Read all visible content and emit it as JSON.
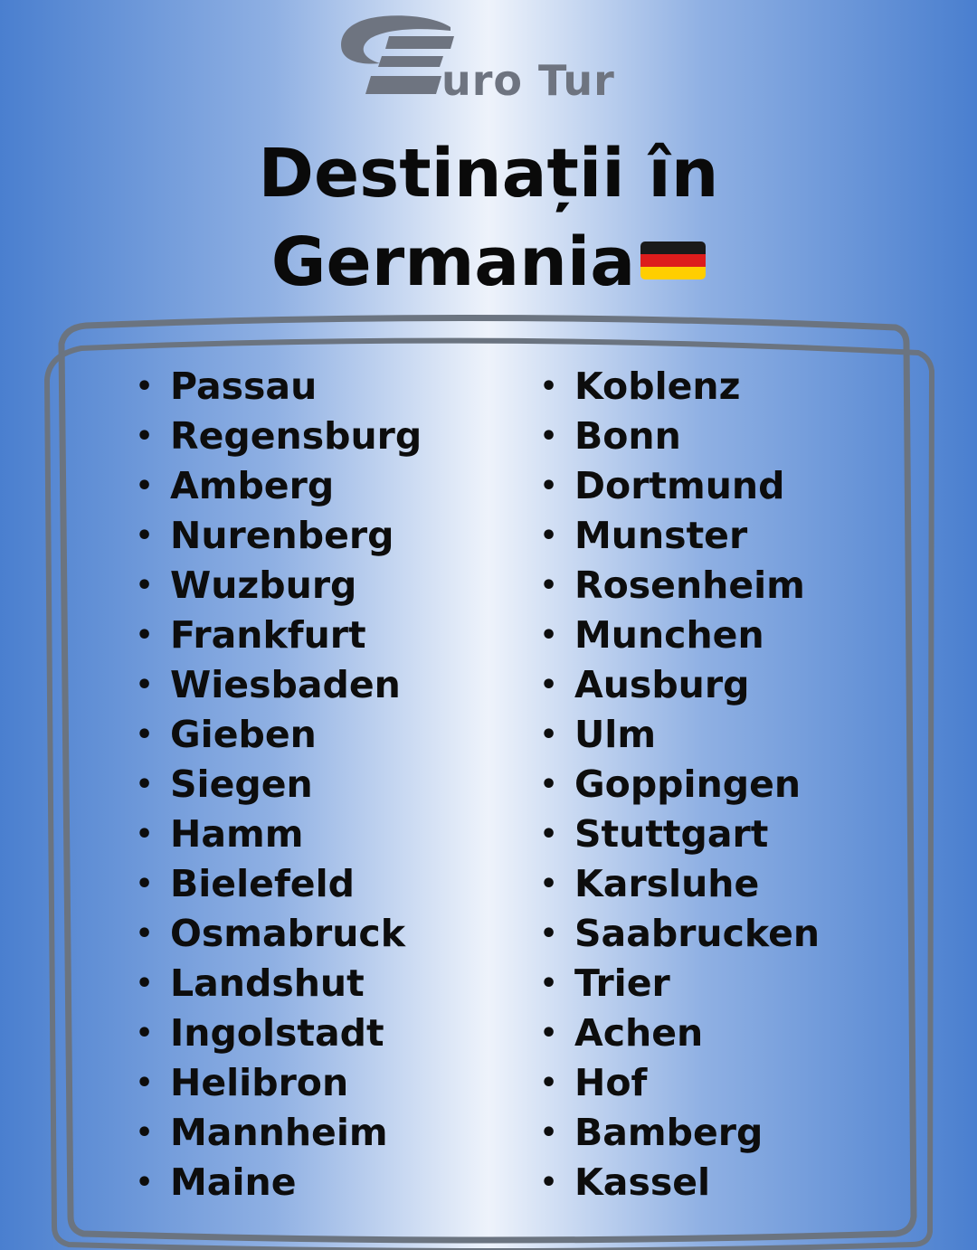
{
  "logo": {
    "text": "uro Tur",
    "color": "#6e7480",
    "icon": "euro-tur-e-emblem"
  },
  "title": {
    "line1": "Destinații în",
    "line2": "Germania",
    "flag_icon": "germany-flag-icon",
    "flag_colors": [
      "#1a1a1a",
      "#dd1c1c",
      "#ffce00"
    ]
  },
  "bullet": "•",
  "destinations": {
    "left": [
      "Passau",
      "Regensburg",
      "Amberg",
      "Nurenberg",
      "Wuzburg",
      "Frankfurt",
      "Wiesbaden",
      "Gieben",
      "Siegen",
      "Hamm",
      "Bielefeld",
      "Osmabruck",
      "Landshut",
      "Ingolstadt",
      "Helibron",
      "Mannheim",
      "Maine"
    ],
    "right": [
      "Koblenz",
      "Bonn",
      "Dortmund",
      "Munster",
      "Rosenheim",
      "Munchen",
      "Ausburg",
      "Ulm",
      "Goppingen",
      "Stuttgart",
      "Karsluhe",
      "Saabrucken",
      "Trier",
      "Achen",
      "Hof",
      "Bamberg",
      "Kassel"
    ]
  },
  "colors": {
    "background_edge": "#4a7fcf",
    "background_center": "#eef3fb",
    "frame": "#6b7480",
    "text": "#0d0d0d"
  }
}
